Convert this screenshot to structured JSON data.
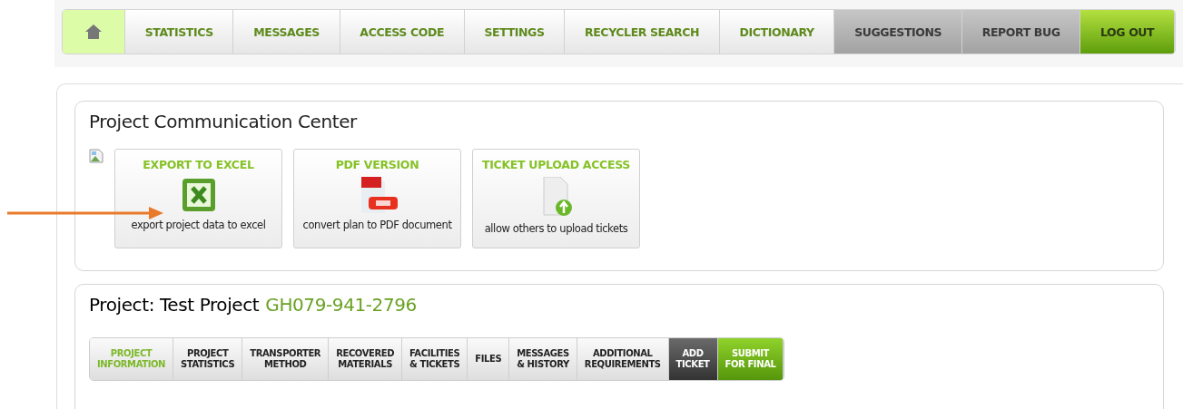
{
  "nav": [
    {
      "kind": "home"
    },
    {
      "kind": "main",
      "label": "STATISTICS"
    },
    {
      "kind": "main",
      "label": "MESSAGES"
    },
    {
      "kind": "main",
      "label": "ACCESS CODE"
    },
    {
      "kind": "main",
      "label": "SETTINGS"
    },
    {
      "kind": "main",
      "label": "RECYCLER SEARCH"
    },
    {
      "kind": "main",
      "label": "DICTIONARY"
    },
    {
      "kind": "grey",
      "label": "SUGGESTIONS"
    },
    {
      "kind": "grey",
      "label": "REPORT BUG"
    },
    {
      "kind": "logout",
      "label": "LOG OUT"
    }
  ],
  "communication": {
    "title": "Project Communication Center",
    "tiles": [
      {
        "kind": "excel",
        "title": "EXPORT TO EXCEL",
        "caption": "export project data to excel"
      },
      {
        "kind": "pdf",
        "title": "PDF VERSION",
        "caption": "convert plan to PDF document"
      },
      {
        "kind": "upload",
        "title": "TICKET UPLOAD ACCESS",
        "caption": "allow others to upload tickets"
      }
    ]
  },
  "project": {
    "label": "Project: Test Project",
    "code": "GH079-941-2796",
    "tabs": [
      {
        "kind": "normal",
        "selected": true,
        "lines": [
          "PROJECT",
          "INFORMATION"
        ]
      },
      {
        "kind": "normal",
        "selected": false,
        "lines": [
          "PROJECT",
          "STATISTICS"
        ]
      },
      {
        "kind": "normal",
        "selected": false,
        "lines": [
          "TRANSPORTER",
          "METHOD"
        ]
      },
      {
        "kind": "normal",
        "selected": false,
        "lines": [
          "RECOVERED",
          "MATERIALS"
        ]
      },
      {
        "kind": "normal",
        "selected": false,
        "lines": [
          "FACILITIES",
          "& TICKETS"
        ]
      },
      {
        "kind": "normal",
        "selected": false,
        "lines": [
          "FILES"
        ]
      },
      {
        "kind": "normal",
        "selected": false,
        "lines": [
          "MESSAGES",
          "& HISTORY"
        ]
      },
      {
        "kind": "normal",
        "selected": false,
        "lines": [
          "ADDITIONAL",
          "REQUIREMENTS"
        ]
      },
      {
        "kind": "dark",
        "selected": false,
        "lines": [
          "ADD",
          "TICKET"
        ]
      },
      {
        "kind": "green",
        "selected": false,
        "lines": [
          "SUBMIT",
          "FOR FINAL"
        ]
      }
    ]
  }
}
